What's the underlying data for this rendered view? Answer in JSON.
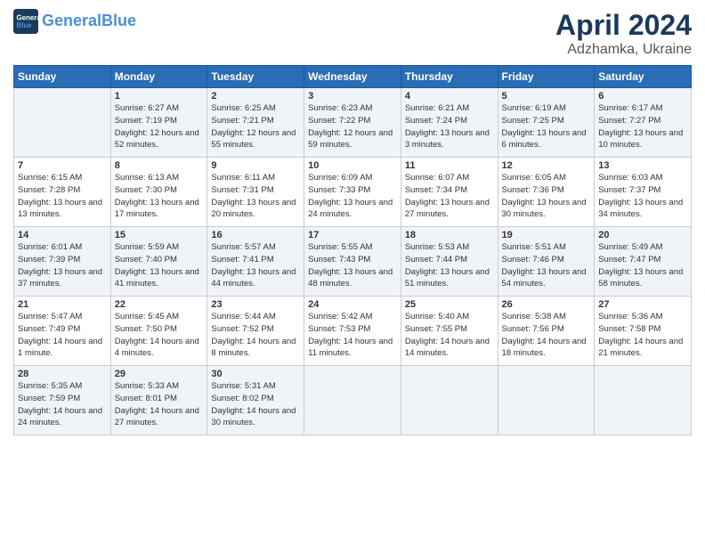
{
  "header": {
    "logo_line1": "General",
    "logo_line2": "Blue",
    "month_year": "April 2024",
    "location": "Adzhamka, Ukraine"
  },
  "days_of_week": [
    "Sunday",
    "Monday",
    "Tuesday",
    "Wednesday",
    "Thursday",
    "Friday",
    "Saturday"
  ],
  "weeks": [
    [
      {
        "day": "",
        "info": ""
      },
      {
        "day": "1",
        "info": "Sunrise: 6:27 AM\nSunset: 7:19 PM\nDaylight: 12 hours\nand 52 minutes."
      },
      {
        "day": "2",
        "info": "Sunrise: 6:25 AM\nSunset: 7:21 PM\nDaylight: 12 hours\nand 55 minutes."
      },
      {
        "day": "3",
        "info": "Sunrise: 6:23 AM\nSunset: 7:22 PM\nDaylight: 12 hours\nand 59 minutes."
      },
      {
        "day": "4",
        "info": "Sunrise: 6:21 AM\nSunset: 7:24 PM\nDaylight: 13 hours\nand 3 minutes."
      },
      {
        "day": "5",
        "info": "Sunrise: 6:19 AM\nSunset: 7:25 PM\nDaylight: 13 hours\nand 6 minutes."
      },
      {
        "day": "6",
        "info": "Sunrise: 6:17 AM\nSunset: 7:27 PM\nDaylight: 13 hours\nand 10 minutes."
      }
    ],
    [
      {
        "day": "7",
        "info": "Sunrise: 6:15 AM\nSunset: 7:28 PM\nDaylight: 13 hours\nand 13 minutes."
      },
      {
        "day": "8",
        "info": "Sunrise: 6:13 AM\nSunset: 7:30 PM\nDaylight: 13 hours\nand 17 minutes."
      },
      {
        "day": "9",
        "info": "Sunrise: 6:11 AM\nSunset: 7:31 PM\nDaylight: 13 hours\nand 20 minutes."
      },
      {
        "day": "10",
        "info": "Sunrise: 6:09 AM\nSunset: 7:33 PM\nDaylight: 13 hours\nand 24 minutes."
      },
      {
        "day": "11",
        "info": "Sunrise: 6:07 AM\nSunset: 7:34 PM\nDaylight: 13 hours\nand 27 minutes."
      },
      {
        "day": "12",
        "info": "Sunrise: 6:05 AM\nSunset: 7:36 PM\nDaylight: 13 hours\nand 30 minutes."
      },
      {
        "day": "13",
        "info": "Sunrise: 6:03 AM\nSunset: 7:37 PM\nDaylight: 13 hours\nand 34 minutes."
      }
    ],
    [
      {
        "day": "14",
        "info": "Sunrise: 6:01 AM\nSunset: 7:39 PM\nDaylight: 13 hours\nand 37 minutes."
      },
      {
        "day": "15",
        "info": "Sunrise: 5:59 AM\nSunset: 7:40 PM\nDaylight: 13 hours\nand 41 minutes."
      },
      {
        "day": "16",
        "info": "Sunrise: 5:57 AM\nSunset: 7:41 PM\nDaylight: 13 hours\nand 44 minutes."
      },
      {
        "day": "17",
        "info": "Sunrise: 5:55 AM\nSunset: 7:43 PM\nDaylight: 13 hours\nand 48 minutes."
      },
      {
        "day": "18",
        "info": "Sunrise: 5:53 AM\nSunset: 7:44 PM\nDaylight: 13 hours\nand 51 minutes."
      },
      {
        "day": "19",
        "info": "Sunrise: 5:51 AM\nSunset: 7:46 PM\nDaylight: 13 hours\nand 54 minutes."
      },
      {
        "day": "20",
        "info": "Sunrise: 5:49 AM\nSunset: 7:47 PM\nDaylight: 13 hours\nand 58 minutes."
      }
    ],
    [
      {
        "day": "21",
        "info": "Sunrise: 5:47 AM\nSunset: 7:49 PM\nDaylight: 14 hours\nand 1 minute."
      },
      {
        "day": "22",
        "info": "Sunrise: 5:45 AM\nSunset: 7:50 PM\nDaylight: 14 hours\nand 4 minutes."
      },
      {
        "day": "23",
        "info": "Sunrise: 5:44 AM\nSunset: 7:52 PM\nDaylight: 14 hours\nand 8 minutes."
      },
      {
        "day": "24",
        "info": "Sunrise: 5:42 AM\nSunset: 7:53 PM\nDaylight: 14 hours\nand 11 minutes."
      },
      {
        "day": "25",
        "info": "Sunrise: 5:40 AM\nSunset: 7:55 PM\nDaylight: 14 hours\nand 14 minutes."
      },
      {
        "day": "26",
        "info": "Sunrise: 5:38 AM\nSunset: 7:56 PM\nDaylight: 14 hours\nand 18 minutes."
      },
      {
        "day": "27",
        "info": "Sunrise: 5:36 AM\nSunset: 7:58 PM\nDaylight: 14 hours\nand 21 minutes."
      }
    ],
    [
      {
        "day": "28",
        "info": "Sunrise: 5:35 AM\nSunset: 7:59 PM\nDaylight: 14 hours\nand 24 minutes."
      },
      {
        "day": "29",
        "info": "Sunrise: 5:33 AM\nSunset: 8:01 PM\nDaylight: 14 hours\nand 27 minutes."
      },
      {
        "day": "30",
        "info": "Sunrise: 5:31 AM\nSunset: 8:02 PM\nDaylight: 14 hours\nand 30 minutes."
      },
      {
        "day": "",
        "info": ""
      },
      {
        "day": "",
        "info": ""
      },
      {
        "day": "",
        "info": ""
      },
      {
        "day": "",
        "info": ""
      }
    ]
  ]
}
